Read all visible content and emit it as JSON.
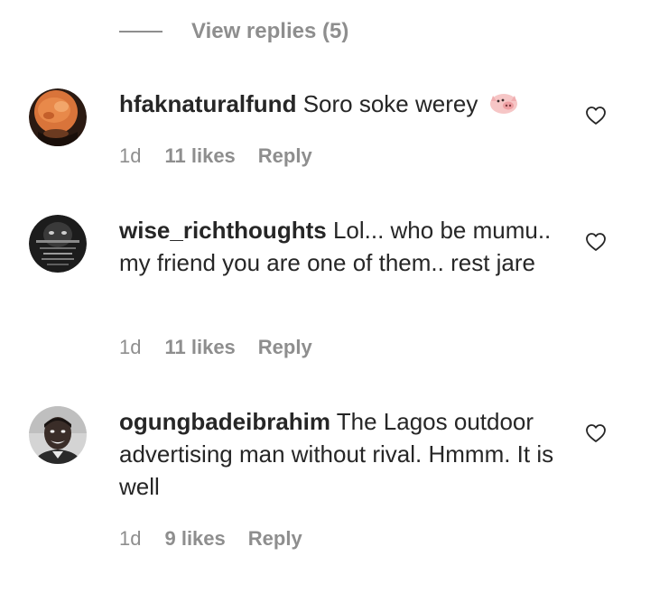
{
  "view_replies": {
    "label": "View replies (5)"
  },
  "comments": [
    {
      "username": "hfaknaturalfund",
      "text": "Soro soke werey",
      "emoji": "pig-face",
      "time": "1d",
      "likes": "11 likes",
      "reply": "Reply",
      "avatar_icon": "orange-food-avatar"
    },
    {
      "username": "wise_richthoughts",
      "text": "Lol... who be mumu.. my friend you are one of them.. rest jare",
      "time": "1d",
      "likes": "11 likes",
      "reply": "Reply",
      "avatar_icon": "dark-face-text-avatar"
    },
    {
      "username": "ogungbadeibrahim",
      "text": "The Lagos outdoor advertising man without rival. Hmmm. It is well",
      "time": "1d",
      "likes": "9 likes",
      "reply": "Reply",
      "avatar_icon": "man-portrait-avatar"
    }
  ],
  "colors": {
    "text_primary": "#262626",
    "text_secondary": "#8e8e8e",
    "background": "#ffffff"
  }
}
